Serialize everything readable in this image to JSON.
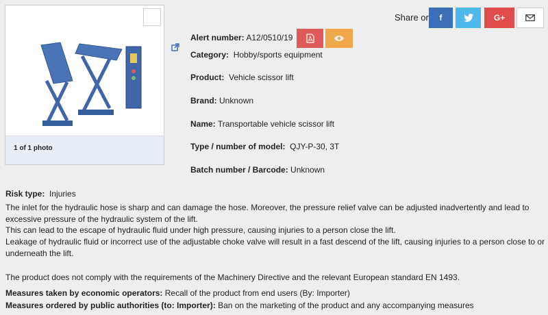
{
  "photo": {
    "counter": "1 of 1 photo",
    "expand_icon": "external-link-icon"
  },
  "share": {
    "label": "Share on",
    "facebook": "f",
    "googleplus": "G+",
    "colors": {
      "facebook": "#3b6eb7",
      "twitter": "#4fb8ea",
      "googleplus": "#de4c4c"
    }
  },
  "details": {
    "alert_label": "Alert number:",
    "alert_value": "A12/0510/19",
    "category_label": "Category:",
    "category_value": "Hobby/sports equipment",
    "product_label": "Product:",
    "product_value": "Vehicle scissor lift",
    "brand_label": "Brand:",
    "brand_value": "Unknown",
    "name_label": "Name:",
    "name_value": "Transportable vehicle scissor lift",
    "type_label": "Type / number of model:",
    "type_value": "QJY-P-30, 3T",
    "batch_label": "Batch number / Barcode:",
    "batch_value": "Unknown"
  },
  "risk": {
    "label": "Risk type:",
    "value": "Injuries",
    "p1": "The inlet for the hydraulic hose is sharp and can damage the hose. Moreover, the pressure relief valve can be adjusted inadvertently and lead to excessive pressure of the hydraulic system of the lift.",
    "p2": "This can lead to the escape of hydraulic fluid under high pressure, causing injuries to a person close the lift.",
    "p3": "Leakage of hydraulic fluid or incorrect use of the adjustable choke valve will result in a fast descend of the lift, causing injuries to a person close to or underneath the lift.",
    "p4": "The product does not comply with the requirements of the Machinery Directive and the relevant European standard EN 1493."
  },
  "measures": {
    "economic_label": "Measures taken by economic operators:",
    "economic_value": "Recall of the product from end users (By: Importer)",
    "authorities_label": "Measures ordered by public authorities (to: Importer):",
    "authorities_value": "Ban on the marketing of the product and any accompanying measures"
  }
}
